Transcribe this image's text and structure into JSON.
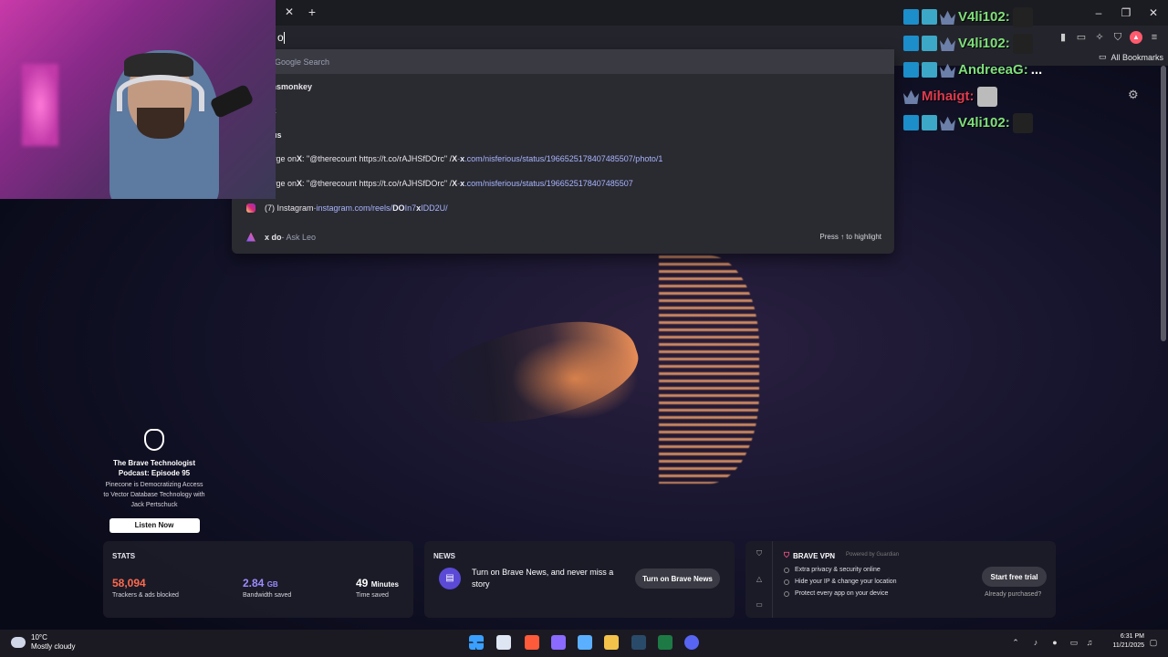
{
  "browser": {
    "tab_close_glyph": "✕",
    "tab_new_glyph": "+",
    "address_text": "o",
    "bookmarks_label": "All Bookmarks"
  },
  "omnibox": {
    "rows": [
      {
        "bold": "o",
        "rest": " - Google Search",
        "url": "",
        "icon": "search-icon"
      },
      {
        "bold": "kinsmonkey",
        "rest": "",
        "url": "",
        "icon": "history-icon"
      },
      {
        "bold": "ick",
        "rest": "",
        "url": "",
        "icon": "history-icon"
      },
      {
        "bold": "inus",
        "rest": "",
        "url": "",
        "icon": "history-icon"
      },
      {
        "pre": "Jorge on ",
        "bold": "X",
        "rest": ": \"@therecount https://t.co/rAJHSfDOrc\" / ",
        "bold2": "X",
        "dash": " - ",
        "url_bold": "x",
        "url": ".com/nisferious/status/1966525178407485507/photo/1",
        "icon": "x-icon"
      },
      {
        "pre": "Jorge on ",
        "bold": "X",
        "rest": ": \"@therecount https://t.co/rAJHSfDOrc\" / ",
        "bold2": "X",
        "dash": " - ",
        "url_bold": "x",
        "url": ".com/nisferious/status/1966525178407485507",
        "icon": "x-icon"
      },
      {
        "pre": "(7) Instagram",
        "dash": " - ",
        "url": "instagram.com/reels/",
        "url_bold": "DO",
        "url_tail": "In7",
        "url_bold2": "x",
        "url_tail2": "IDD2U/",
        "icon": "instagram-icon"
      },
      {
        "bold": "x do",
        "rest": " - Ask Leo",
        "hint": "Press ↑ to highlight",
        "icon": "leo-icon"
      }
    ]
  },
  "chat": {
    "messages": [
      {
        "user": "V4li102:",
        "color": "green",
        "text": ""
      },
      {
        "user": "V4li102:",
        "color": "green",
        "text": ""
      },
      {
        "user": "AndreeaG:",
        "color": "green",
        "text": "..."
      },
      {
        "user": "Mihaigt:",
        "color": "red",
        "text": ""
      },
      {
        "user": "V4li102:",
        "color": "green",
        "text": ""
      }
    ]
  },
  "promo": {
    "title": "The Brave Technologist Podcast: Episode 95",
    "subtitle": "Pinecone is Democratizing Access to Vector Database Technology with Jack Pertschuck",
    "button": "Listen Now"
  },
  "stats": {
    "heading": "STATS",
    "trackers_value": "58,094",
    "trackers_label": "Trackers & ads blocked",
    "bandwidth_value": "2.84",
    "bandwidth_unit": "GB",
    "bandwidth_label": "Bandwidth saved",
    "time_value": "49",
    "time_unit": "Minutes",
    "time_label": "Time saved",
    "colors": {
      "trackers": "#ff6a4d",
      "bandwidth": "#9b8cff",
      "time": "#ffffff"
    }
  },
  "news": {
    "heading": "NEWS",
    "text": "Turn on Brave News, and never miss a story",
    "button": "Turn on Brave News"
  },
  "vpn": {
    "title": "BRAVE VPN",
    "powered": "Powered by",
    "powered_brand": "Guardian",
    "items": [
      "Extra privacy & security online",
      "Hide your IP & change your location",
      "Protect every app on your device"
    ],
    "button": "Start free trial",
    "already": "Already purchased?"
  },
  "taskbar": {
    "temp": "10°C",
    "weather": "Mostly cloudy",
    "time": "6:31 PM",
    "date": "11/21/2025"
  }
}
